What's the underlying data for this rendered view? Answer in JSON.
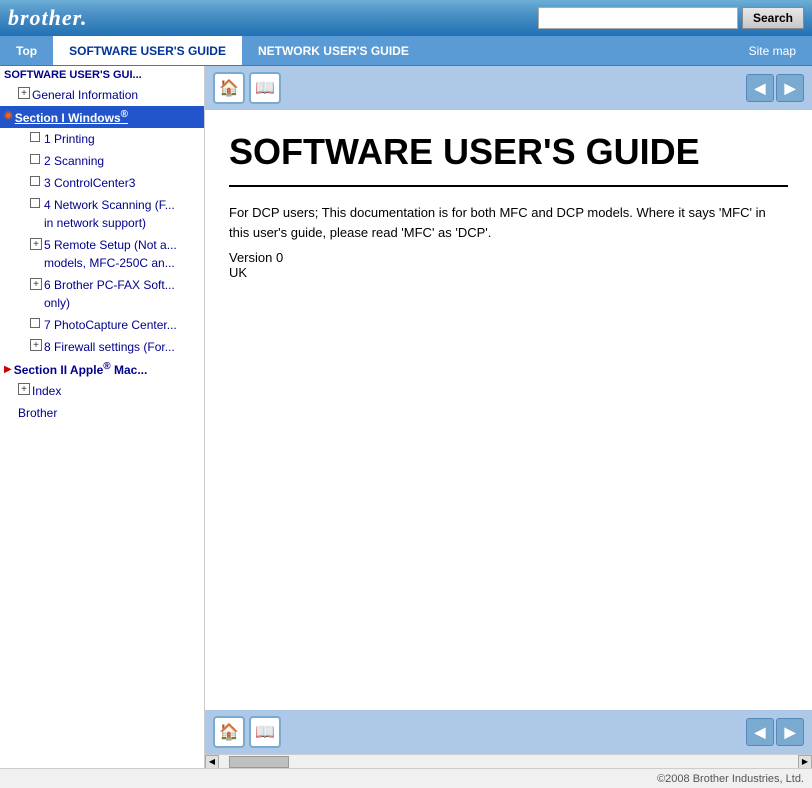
{
  "header": {
    "logo": "brother.",
    "search_placeholder": "",
    "search_button": "Search"
  },
  "navbar": {
    "tabs": [
      {
        "id": "top",
        "label": "Top",
        "active": false
      },
      {
        "id": "software",
        "label": "SOFTWARE USER'S GUIDE",
        "active": true
      },
      {
        "id": "network",
        "label": "NETWORK USER'S GUIDE",
        "active": false
      }
    ],
    "sitemap": "Site map"
  },
  "sidebar": {
    "title": "SOFTWARE USER'S GUI...",
    "items": [
      {
        "id": "root",
        "label": "SOFTWARE USER'S GUI...",
        "type": "root",
        "indent": 0
      },
      {
        "id": "general-info",
        "label": "General Information",
        "type": "item",
        "indent": 1,
        "icon": "plus"
      },
      {
        "id": "section1",
        "label": "Section I Windows®",
        "type": "section-active",
        "indent": 0
      },
      {
        "id": "item1",
        "label": "1 Printing",
        "type": "checkbox-item",
        "indent": 2
      },
      {
        "id": "item2",
        "label": "2 Scanning",
        "type": "checkbox-item",
        "indent": 2
      },
      {
        "id": "item3",
        "label": "3 ControlCenter3",
        "type": "checkbox-item",
        "indent": 2
      },
      {
        "id": "item4",
        "label": "4 Network Scanning (F... in network support)",
        "type": "checkbox-item",
        "indent": 2
      },
      {
        "id": "item5",
        "label": "5 Remote Setup (Not a... models, MFC-250C an...",
        "type": "plus-item",
        "indent": 2
      },
      {
        "id": "item6",
        "label": "6 Brother PC-FAX Soft... only)",
        "type": "plus-item",
        "indent": 2
      },
      {
        "id": "item7",
        "label": "7 PhotoCapture Center...",
        "type": "checkbox-item",
        "indent": 2
      },
      {
        "id": "item8",
        "label": "8 Firewall settings (For...",
        "type": "plus-item",
        "indent": 2
      },
      {
        "id": "section2",
        "label": "Section II Apple® Mac...",
        "type": "section",
        "indent": 0
      },
      {
        "id": "index",
        "label": "Index",
        "type": "plus-item",
        "indent": 1
      },
      {
        "id": "brother",
        "label": "Brother",
        "type": "item",
        "indent": 1
      }
    ]
  },
  "content": {
    "title": "SOFTWARE USER'S GUIDE",
    "description": "For DCP users; This documentation is for both MFC and DCP models. Where it says 'MFC' in this user's guide, please read 'MFC' as 'DCP'.",
    "version": "Version 0",
    "locale": "UK"
  },
  "statusbar": {
    "copyright": "©2008 Brother Industries, Ltd."
  },
  "icons": {
    "home": "🏠",
    "book": "📖",
    "left_arrow": "◀",
    "right_arrow": "▶"
  }
}
